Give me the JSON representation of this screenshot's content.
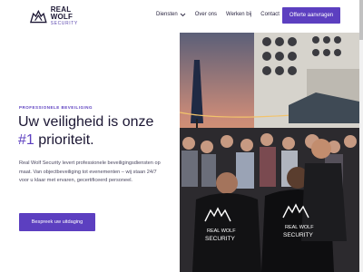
{
  "brand": {
    "name": "REAL WOLF",
    "sub": "SECURITY",
    "logo_icon": "wolf-shield-icon"
  },
  "nav": {
    "items": [
      {
        "label": "Diensten",
        "has_dropdown": true
      },
      {
        "label": "Over ons"
      },
      {
        "label": "Werken bij"
      },
      {
        "label": "Contact"
      }
    ],
    "cta_label": "Offerte aanvragen"
  },
  "hero": {
    "eyebrow": "PROFESSIONELE BEVEILIGING",
    "headline_line1": "Uw veiligheid is onze",
    "headline_accent": "#1",
    "headline_rest": " prioriteit.",
    "intro": "Real Wolf Security levert professionele beveiligingsdiensten op maat. Van objectbeveiliging tot evenementen – wij staan 24/7 voor u klaar met ervaren, gecertificeerd personeel.",
    "cta_label": "Bespreek uw uitdaging"
  },
  "photo": {
    "shirt_brand": "REAL WOLF",
    "shirt_sub": "SECURITY"
  },
  "colors": {
    "accent": "#5c3fc0",
    "text": "#1b1633"
  }
}
